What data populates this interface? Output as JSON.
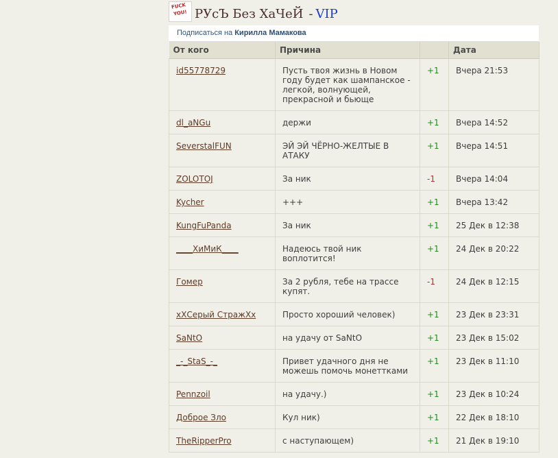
{
  "header": {
    "logo_text_1": "FUCK",
    "logo_text_2": "YOU!",
    "title": "РУсЪ Без ХаЧеЙ",
    "dash": "-",
    "vip": "VIP"
  },
  "subscribe": {
    "prefix": "Подписаться на",
    "name": "Кирилла Мамакова"
  },
  "table": {
    "headers": [
      "От кого",
      "Причина",
      "",
      "Дата"
    ],
    "rows": [
      {
        "from": "id55778729",
        "reason": "Пусть твоя жизнь в Новом году будет как шампанское - легкой, волнующей, прекрасной и бьюще",
        "vote": "+1",
        "date": "Вчера 21:53"
      },
      {
        "from": "dl_aNGu",
        "reason": "держи",
        "vote": "+1",
        "date": "Вчера 14:52"
      },
      {
        "from": "SeverstalFUN",
        "reason": "ЭЙ ЭЙ ЧЁРНО-ЖЕЛТЫЕ В АТАКУ",
        "vote": "+1",
        "date": "Вчера 14:51"
      },
      {
        "from": "ZOLOTOJ",
        "reason": "За ник",
        "vote": "-1",
        "date": "Вчера 14:04"
      },
      {
        "from": "Kycher",
        "reason": "+++",
        "vote": "+1",
        "date": "Вчера 13:42"
      },
      {
        "from": "KungFuPanda",
        "reason": "За ник",
        "vote": "+1",
        "date": "25 Дек в 12:38"
      },
      {
        "from": "____ХиМиК____",
        "reason": "Надеюсь твой ник воплотится!",
        "vote": "+1",
        "date": "24 Дек в 20:22"
      },
      {
        "from": "Гомер",
        "reason": "За 2 рубля, тебе на трассе купят.",
        "vote": "-1",
        "date": "24 Дек в 12:15"
      },
      {
        "from": "хХСерый СтражХх",
        "reason": "Просто хороший человек)",
        "vote": "+1",
        "date": "23 Дек в 23:31"
      },
      {
        "from": "SaNtO",
        "reason": "на удачу от SaNtO",
        "vote": "+1",
        "date": "23 Дек в 15:02"
      },
      {
        "from": "_-_StaS_-_",
        "reason": "Привет удачного дня не можешь помочь монеттками",
        "vote": "+1",
        "date": "23 Дек в 11:10"
      },
      {
        "from": "Pennzoil",
        "reason": "на удачу.)",
        "vote": "+1",
        "date": "23 Дек в 10:24"
      },
      {
        "from": "Доброе Зло",
        "reason": "Кул ник)",
        "vote": "+1",
        "date": "22 Дек в 18:10"
      },
      {
        "from": "TheRipperPro",
        "reason": "с наступающем)",
        "vote": "+1",
        "date": "21 Дек в 19:10"
      }
    ]
  },
  "colors": {
    "background": "#f1f0e8",
    "positive": "#1f8a1f",
    "negative": "#c0272d",
    "vip": "#1a3ccd",
    "link": "#5c3b29"
  }
}
